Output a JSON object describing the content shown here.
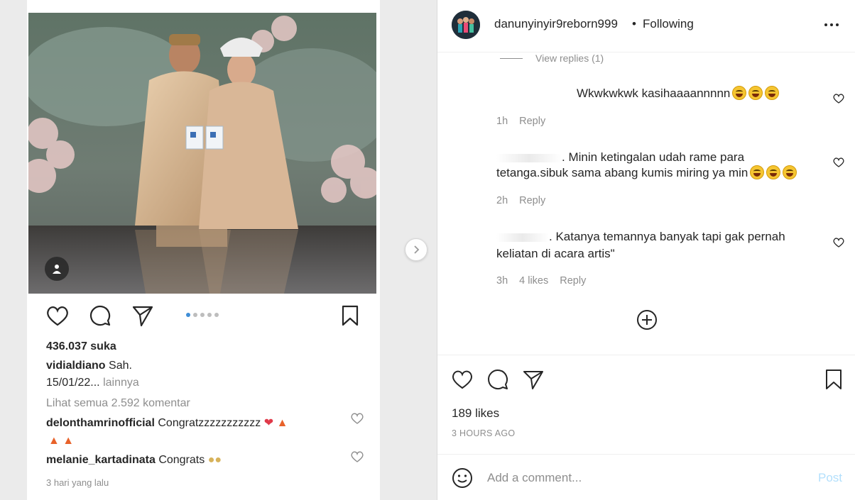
{
  "left": {
    "carousel": {
      "total": 5,
      "active": 0
    },
    "likes": "436.037 suka",
    "caption_user": "vidialdiano",
    "caption_text": "Sah.",
    "caption_date": "15/01/22...",
    "caption_more": "lainnya",
    "view_all": "Lihat semua 2.592 komentar",
    "comments": [
      {
        "user": "delonthamrinofficial",
        "text": "Congratzzzzzzzzzzz"
      },
      {
        "user": "melanie_kartadinata",
        "text": "Congrats"
      }
    ],
    "timestamp": "3 hari yang lalu"
  },
  "header": {
    "username": "danunyinyir9reborn999",
    "separator": "•",
    "follow_status": "Following"
  },
  "comments": {
    "view_replies": "View replies (1)",
    "items": [
      {
        "text": "Wkwkwkwk kasihaaaannnnn",
        "time": "1h",
        "likes": "",
        "reply": "Reply"
      },
      {
        "text_line1": ". Minin ketingalan udah rame para",
        "text_line2": "tetanga.sibuk sama abang kumis miring ya min",
        "time": "2h",
        "likes": "",
        "reply": "Reply"
      },
      {
        "text_line1": ". Katanya temannya banyak tapi gak pernah",
        "text_line2": "keliatan di acara artis\"",
        "time": "3h",
        "likes": "4 likes",
        "reply": "Reply"
      }
    ]
  },
  "post": {
    "likes": "189 likes",
    "time_ago": "3 HOURS AGO"
  },
  "comment_box": {
    "placeholder": "Add a comment...",
    "post_label": "Post"
  },
  "icons": {
    "heart": "heart-icon",
    "comment": "comment-icon",
    "share": "share-icon",
    "save": "bookmark-icon",
    "more": "more-icon",
    "emoji": "emoji-icon",
    "add": "plus-circle-icon"
  },
  "colors": {
    "text": "#262626",
    "muted": "#8e8e8e",
    "post_disabled": "#b2dffc",
    "carousel_active": "#3f8ed6"
  }
}
